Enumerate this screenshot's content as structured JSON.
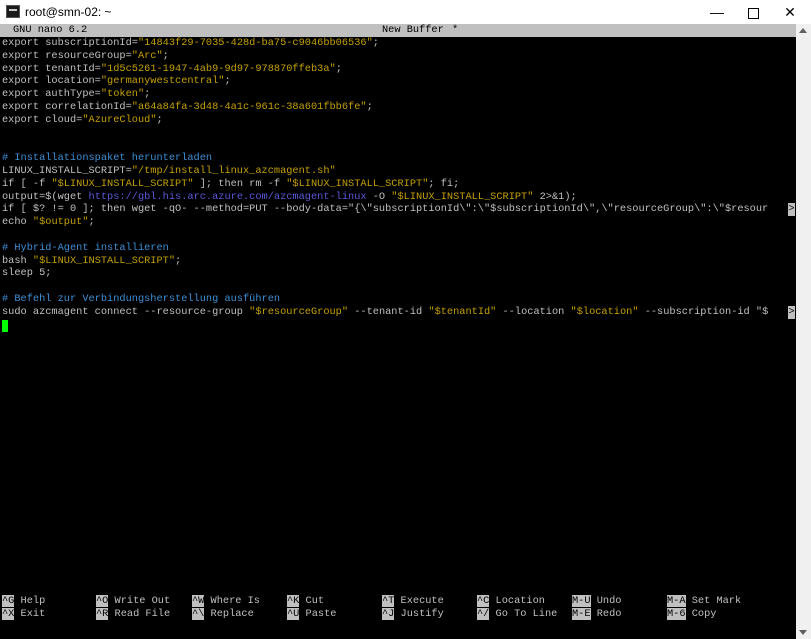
{
  "window": {
    "title": "root@smn-02: ~",
    "minimize_glyph": "—",
    "close_glyph": "✕"
  },
  "nano": {
    "version": "GNU nano 6.2",
    "buffer_name": "New Buffer",
    "modified_flag": "*"
  },
  "editor": {
    "lines": [
      {
        "text": "export subscriptionId=\"14843f29-7035-428d-ba75-c9046bb06536\";"
      },
      {
        "text": "export resourceGroup=\"Arc\";"
      },
      {
        "text": "export tenantId=\"1d5c5261-1947-4ab9-9d97-978870ffeb3a\";"
      },
      {
        "text": "export location=\"germanywestcentral\";"
      },
      {
        "text": "export authType=\"token\";"
      },
      {
        "text": "export correlationId=\"a64a84fa-3d48-4a1c-961c-38a601fbb6fe\";"
      },
      {
        "text": "export cloud=\"AzureCloud\";"
      },
      {
        "text": ""
      },
      {
        "text": ""
      },
      {
        "text": "# Installationspaket herunterladen"
      },
      {
        "text": "LINUX_INSTALL_SCRIPT=\"/tmp/install_linux_azcmagent.sh\""
      },
      {
        "text": "if [ -f \"$LINUX_INSTALL_SCRIPT\" ]; then rm -f \"$LINUX_INSTALL_SCRIPT\"; fi;"
      },
      {
        "pre": "output=$(wget ",
        "url": "https://gbl.his.arc.azure.com/azcmagent-linux",
        "post": " -O \"$LINUX_INSTALL_SCRIPT\" 2>&1);"
      },
      {
        "text": "if [ $? != 0 ]; then wget -qO- --method=PUT --body-data=\"{\\\"subscriptionId\\\":\\\"$subscriptionId\\\",\\\"resourceGroup\\\":\\\"$resour"
      },
      {
        "text": "echo \"$output\";"
      },
      {
        "text": ""
      },
      {
        "text": "# Hybrid-Agent installieren"
      },
      {
        "text": "bash \"$LINUX_INSTALL_SCRIPT\";"
      },
      {
        "text": "sleep 5;"
      },
      {
        "text": ""
      },
      {
        "text": "# Befehl zur Verbindungsherstellung ausführen"
      },
      {
        "text": "sudo azcmagent connect --resource-group \"$resourceGroup\" --tenant-id \"$tenantId\" --location \"$location\" --subscription-id \"$"
      }
    ],
    "truncation_marker": ">"
  },
  "shortcuts": [
    {
      "key": "^G",
      "label": "Help"
    },
    {
      "key": "^X",
      "label": "Exit"
    },
    {
      "key": "^O",
      "label": "Write Out"
    },
    {
      "key": "^R",
      "label": "Read File"
    },
    {
      "key": "^W",
      "label": "Where Is"
    },
    {
      "key": "^\\",
      "label": "Replace"
    },
    {
      "key": "^K",
      "label": "Cut"
    },
    {
      "key": "^U",
      "label": "Paste"
    },
    {
      "key": "^T",
      "label": "Execute"
    },
    {
      "key": "^J",
      "label": "Justify"
    },
    {
      "key": "^C",
      "label": "Location"
    },
    {
      "key": "^/",
      "label": "Go To Line"
    },
    {
      "key": "M-U",
      "label": "Undo"
    },
    {
      "key": "M-E",
      "label": "Redo"
    },
    {
      "key": "M-A",
      "label": "Set Mark"
    },
    {
      "key": "M-6",
      "label": "Copy"
    }
  ]
}
